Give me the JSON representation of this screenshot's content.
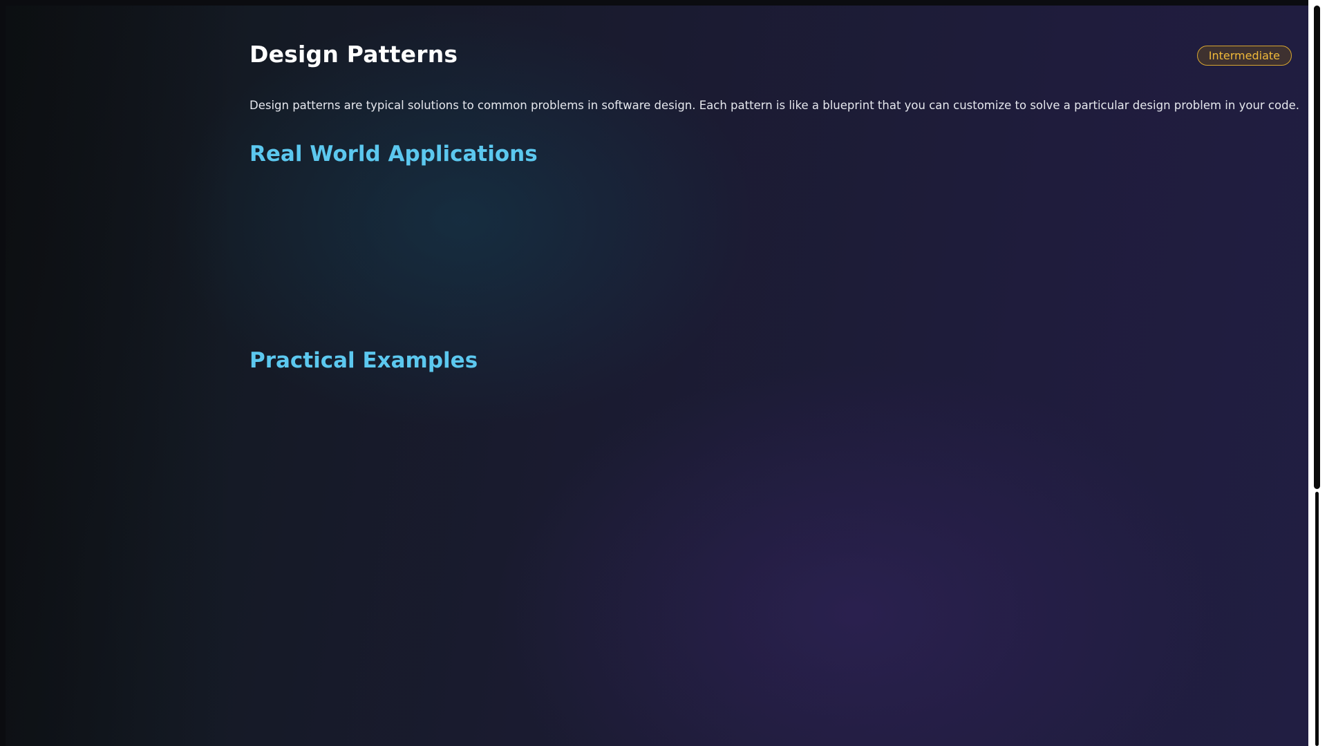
{
  "page": {
    "title": "Design Patterns",
    "level_badge": "Intermediate",
    "intro": "Design patterns are typical solutions to common problems in software design. Each pattern is like a blueprint that you can customize to solve a particular design problem in your code."
  },
  "sections": [
    {
      "heading": "Real World Applications"
    },
    {
      "heading": "Practical Examples"
    }
  ],
  "colors": {
    "title": "#ffffff",
    "section_heading": "#5cc8ef",
    "badge_border": "#d8a630",
    "badge_text": "#f0b93a",
    "body_text": "#e6e8ee"
  }
}
